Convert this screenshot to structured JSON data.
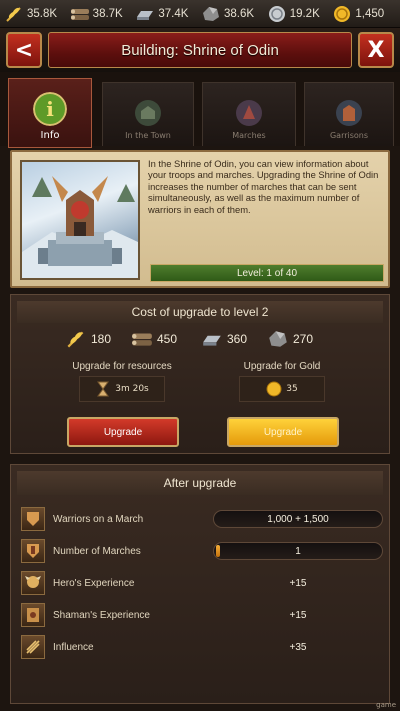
{
  "resources": [
    {
      "icon": "wheat-icon",
      "value": "35.8K"
    },
    {
      "icon": "wood-icon",
      "value": "38.7K"
    },
    {
      "icon": "iron-icon",
      "value": "37.4K"
    },
    {
      "icon": "stone-icon",
      "value": "38.6K"
    },
    {
      "icon": "silver-icon",
      "value": "19.2K"
    },
    {
      "icon": "gold-icon",
      "value": "1,450"
    }
  ],
  "header": {
    "title": "Building: Shrine of Odin",
    "back_label": "<",
    "close_label": "X"
  },
  "tabs": [
    {
      "label": "Info",
      "icon": "info-icon",
      "active": true
    },
    {
      "label": "In the Town",
      "icon": "town-icon",
      "active": false
    },
    {
      "label": "Marches",
      "icon": "marches-icon",
      "active": false
    },
    {
      "label": "Garrisons",
      "icon": "garrisons-icon",
      "active": false
    }
  ],
  "info": {
    "description": "In the Shrine of Odin, you can view information about your troops and marches. Upgrading the Shrine of Odin increases the number of marches that can be sent simultaneously, as well as the maximum number of warriors in each of them.",
    "level_text": "Level: 1 of 40"
  },
  "cost": {
    "title": "Cost of upgrade to level 2",
    "items": [
      {
        "icon": "wheat-icon",
        "value": "180"
      },
      {
        "icon": "wood-icon",
        "value": "450"
      },
      {
        "icon": "iron-icon",
        "value": "360"
      },
      {
        "icon": "stone-icon",
        "value": "270"
      }
    ],
    "resources_label": "Upgrade for resources",
    "resources_time": "3m 20s",
    "gold_label": "Upgrade for Gold",
    "gold_cost": "35",
    "upgrade_button": "Upgrade",
    "gold_button": "Upgrade"
  },
  "after": {
    "title": "After upgrade",
    "rows": [
      {
        "label": "Warriors on a March",
        "value": "1,000 + 1,500",
        "icon": "warriors-icon"
      },
      {
        "label": "Number of Marches",
        "value": "1",
        "icon": "marches-count-icon"
      },
      {
        "label": "Hero's Experience",
        "value": "+15",
        "icon": "hero-icon"
      },
      {
        "label": "Shaman's Experience",
        "value": "+15",
        "icon": "shaman-icon"
      },
      {
        "label": "Influence",
        "value": "+35",
        "icon": "influence-icon"
      }
    ],
    "marches_fill": 0.05
  },
  "colors": {
    "header_red": "#7d130d",
    "level_green": "#2f5a17",
    "gold_button": "#e59a0b",
    "red_button": "#8d1810"
  },
  "watermark": "game"
}
